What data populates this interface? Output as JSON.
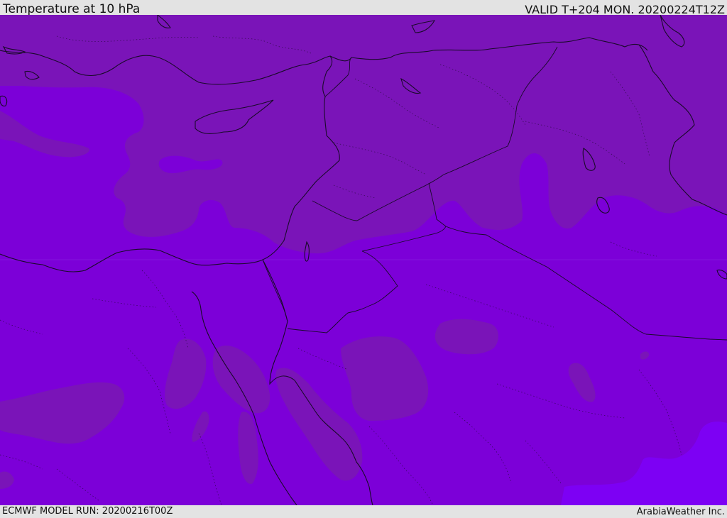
{
  "header": {
    "title": "Temperature at 10 hPa",
    "valid_time": "VALID T+204 MON. 20200224T12Z"
  },
  "footer": {
    "model_run": "ECMWF MODEL RUN: 20200216T00Z",
    "credit": "ArabiaWeather Inc."
  },
  "map": {
    "colors": {
      "warm_band": "#7a14b8",
      "base_band": "#7c00d8",
      "cold_band": "#7d00f4",
      "boundary": "#1a0a2a"
    }
  }
}
